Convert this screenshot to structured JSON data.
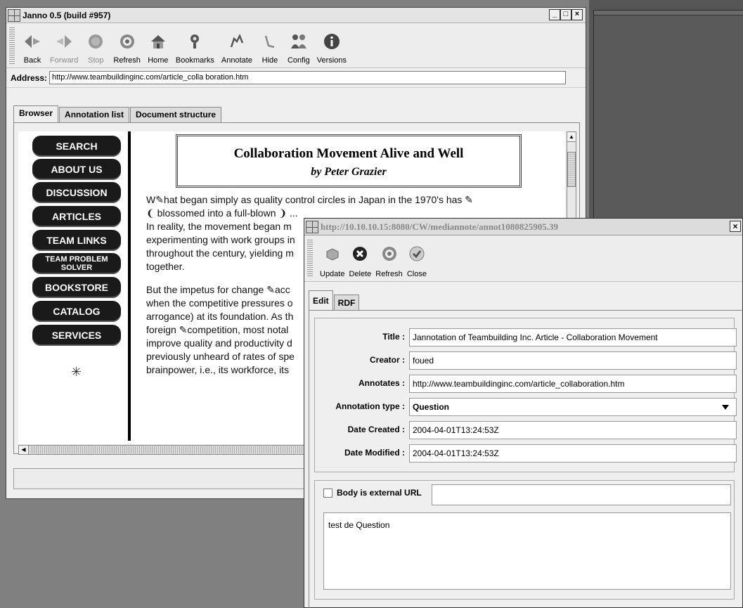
{
  "main_window": {
    "title": "Janno 0.5 (build #957)",
    "window_buttons": [
      "_",
      "□",
      "×"
    ],
    "toolbar": [
      {
        "label": "Back",
        "icon": "back-arrow-icon",
        "enabled": true
      },
      {
        "label": "Forward",
        "icon": "forward-arrow-icon",
        "enabled": false
      },
      {
        "label": "Stop",
        "icon": "stop-icon",
        "enabled": false
      },
      {
        "label": "Refresh",
        "icon": "refresh-icon",
        "enabled": true
      },
      {
        "label": "Home",
        "icon": "home-icon",
        "enabled": true
      },
      {
        "label": "Bookmarks",
        "icon": "bookmarks-icon",
        "enabled": true
      },
      {
        "label": "Annotate",
        "icon": "annotate-icon",
        "enabled": true
      },
      {
        "label": "Hide",
        "icon": "hide-icon",
        "enabled": true
      },
      {
        "label": "Config",
        "icon": "config-icon",
        "enabled": true
      },
      {
        "label": "Versions",
        "icon": "info-icon",
        "enabled": true
      }
    ],
    "address_label": "Address:",
    "address_value": "http://www.teambuildinginc.com/article_colla boration.htm",
    "tabs": [
      "Browser",
      "Annotation list",
      "Document structure"
    ],
    "active_tab": "Browser"
  },
  "web_page": {
    "nav": [
      "SEARCH",
      "ABOUT US",
      "DISCUSSION",
      "ARTICLES",
      "TEAM LINKS",
      "TEAM PROBLEM SOLVER",
      "BOOKSTORE",
      "CATALOG",
      "SERVICES"
    ],
    "headline": "Collaboration Movement Alive and Well",
    "byline": "by Peter Grazier",
    "para1": [
      "W✎hat began simply as quality control circles in Japan in the 1970's has ✎",
      "❨ blossomed into a full-blown ❩ ...",
      "In reality, the movement began m",
      "experimenting with work groups in",
      "throughout the century, yielding m",
      "together."
    ],
    "para2": [
      "But the impetus for change ✎acc",
      "when the competitive pressures o",
      "arrogance) at its foundation. As th",
      "foreign ✎competition, most notal",
      "improve quality and productivity d",
      "previously unheard of rates of spe",
      "brainpower, i.e., its workforce, its"
    ]
  },
  "popup": {
    "title": "http://10.10.10.15:8080/CW/mediannote/annot1080825905.39",
    "close_label": "×",
    "toolbar": [
      {
        "label": "Update",
        "icon": "update-icon"
      },
      {
        "label": "Delete",
        "icon": "delete-icon"
      },
      {
        "label": "Refresh",
        "icon": "refresh-icon"
      },
      {
        "label": "Close",
        "icon": "close-check-icon"
      }
    ],
    "tabs": [
      "Edit",
      "RDF"
    ],
    "active_tab": "Edit",
    "fields": [
      {
        "label": "Title :",
        "value": "Jannotation of Teambuilding Inc. Article - Collaboration Movement"
      },
      {
        "label": "Creator :",
        "value": "foued"
      },
      {
        "label": "Annotates :",
        "value": "http://www.teambuildinginc.com/article_collaboration.htm"
      },
      {
        "label": "Annotation type :",
        "value": "Question",
        "type": "select"
      },
      {
        "label": "Date Created :",
        "value": "2004-04-01T13:24:53Z"
      },
      {
        "label": "Date Modified :",
        "value": "2004-04-01T13:24:53Z"
      }
    ],
    "body_external_label": "Body is external URL",
    "body_external_checked": false,
    "external_url_value": "",
    "body_text": "test de Question"
  }
}
